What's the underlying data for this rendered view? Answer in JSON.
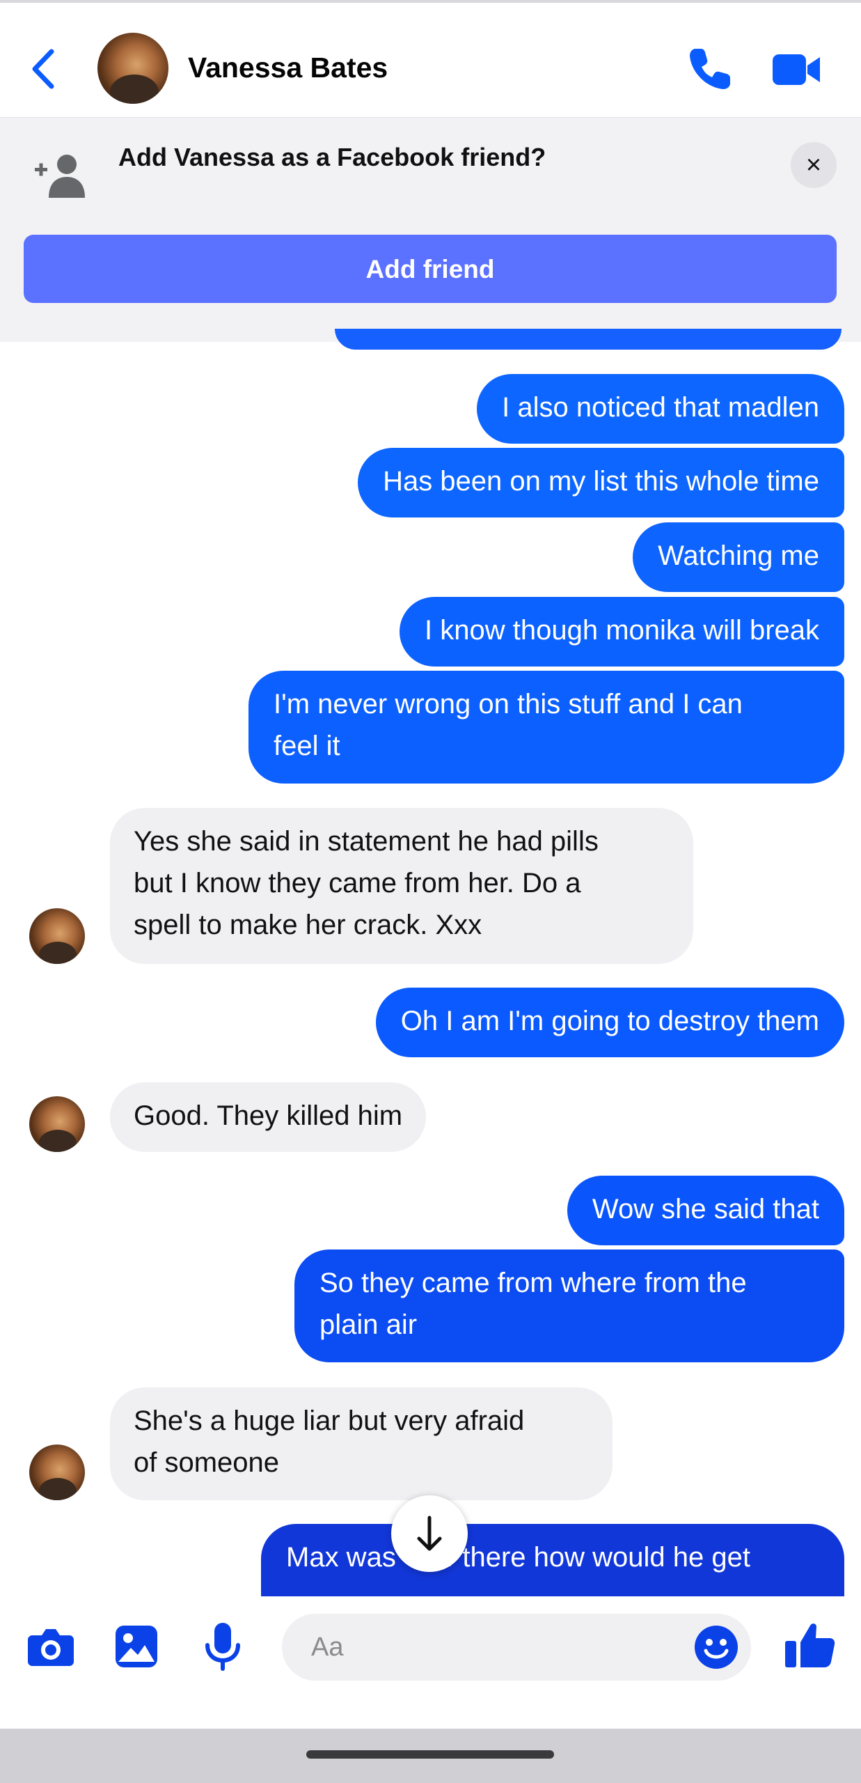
{
  "header": {
    "contact_name": "Vanessa Bates"
  },
  "banner": {
    "prompt": "Add Vanessa as a Facebook friend?",
    "close": "×",
    "button": "Add friend"
  },
  "messages": [
    {
      "from": "me",
      "text": "I also noticed that madlen"
    },
    {
      "from": "me",
      "text": "Has been on my list this whole time"
    },
    {
      "from": "me",
      "text": "Watching me"
    },
    {
      "from": "me",
      "text": "I know though monika will break"
    },
    {
      "from": "me",
      "lines": [
        "I'm never wrong on this stuff and I can",
        "feel it"
      ]
    },
    {
      "from": "them",
      "lines": [
        "Yes she said in statement he had pills",
        "but I know they came from her.   Do a",
        "spell to make her crack.  Xxx"
      ]
    },
    {
      "from": "me",
      "text": "Oh I am I'm going to destroy them"
    },
    {
      "from": "them",
      "text": "Good.  They killed him"
    },
    {
      "from": "me",
      "text": "Wow she said that"
    },
    {
      "from": "me",
      "lines": [
        "So they came from where from the",
        "plain air"
      ]
    },
    {
      "from": "them",
      "lines": [
        "She's a huge liar but very afraid",
        "of someone"
      ]
    },
    {
      "from": "me",
      "text": "Max was     w there how would he get"
    }
  ],
  "composer": {
    "placeholder": "Aa"
  },
  "colors": {
    "accent": "#0a5cff",
    "bubble_top": "#0a6bff",
    "bubble_bottom": "#1a2ad8",
    "incoming_bubble": "#f0f0f3",
    "add_friend_button": "#5b71ff"
  },
  "icons": [
    "back-chevron-icon",
    "phone-icon",
    "video-camera-icon",
    "add-person-icon",
    "close-icon",
    "arrow-down-icon",
    "camera-icon",
    "photo-icon",
    "microphone-icon",
    "emoji-icon",
    "thumbs-up-icon"
  ]
}
